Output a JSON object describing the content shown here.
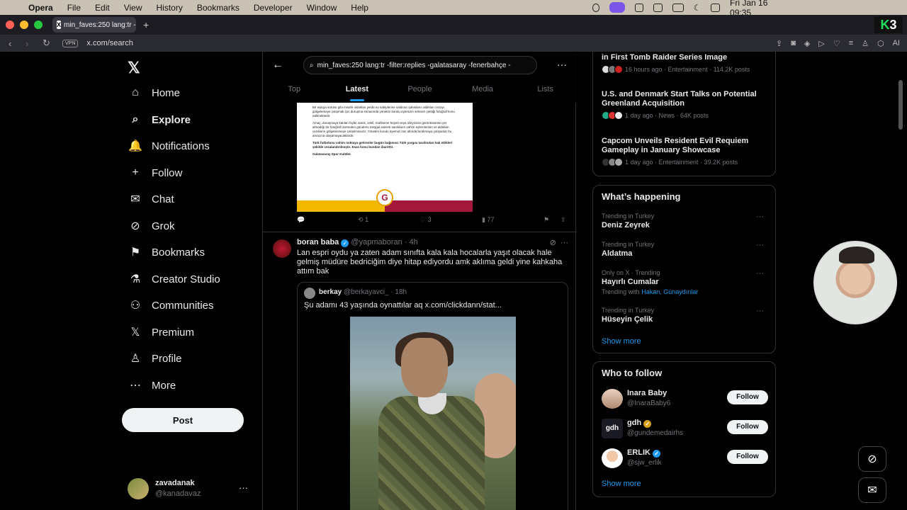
{
  "menubar": {
    "apple": "",
    "items": [
      "Opera",
      "File",
      "Edit",
      "View",
      "History",
      "Bookmarks",
      "Developer",
      "Window",
      "Help"
    ],
    "clock": "Fri Jan 16  09:35"
  },
  "tabbar": {
    "tab_title": "min_faves:250 lang:tr -f",
    "tab_icon": "X",
    "new_tab": "+",
    "badge_k": "K",
    "badge_num": "3"
  },
  "address": {
    "vpn": "VPN",
    "url": "x.com/search",
    "ai_label": "AI"
  },
  "sidebar": {
    "logo": "𝕏",
    "items": [
      {
        "label": "Home",
        "icon": "⌂"
      },
      {
        "label": "Explore",
        "icon": "⌕"
      },
      {
        "label": "Notifications",
        "icon": "🔔"
      },
      {
        "label": "Follow",
        "icon": "+"
      },
      {
        "label": "Chat",
        "icon": "✉"
      },
      {
        "label": "Grok",
        "icon": "⊘"
      },
      {
        "label": "Bookmarks",
        "icon": "⚑"
      },
      {
        "label": "Creator Studio",
        "icon": "⚗"
      },
      {
        "label": "Communities",
        "icon": "⚇"
      },
      {
        "label": "Premium",
        "icon": "𝕏"
      },
      {
        "label": "Profile",
        "icon": "♙"
      },
      {
        "label": "More",
        "icon": "⋯"
      }
    ],
    "post_button": "Post",
    "account": {
      "name": "zavadanak",
      "handle": "@kanadavaz",
      "more": "···"
    }
  },
  "search": {
    "query": "min_faves:250 lang:tr -filter:replies -galatasaray -fenerbahçe -",
    "tabs": [
      "Top",
      "Latest",
      "People",
      "Media",
      "Lists"
    ],
    "active_tab": "Latest"
  },
  "tweet1": {
    "doc_paragraphs": [
      "Bir eşkıya sürüsü gibi misafir olduklan yerde ev sahiplerine saldıran şahısların aldıkları cezayı gölgelemeye çalışmak için duruşma esnasında yönetim kurulu üyemizin selvsen çektiği fotoğraf konu edilmektedir.",
      "Amaç, duruşmaya katılan hiçbir sanık, vekil, mahkeme heyeti veya izleyicinin görüntüsünün yer almadığı bir fotoğraf üzerinden gündemi meşgul ederek sanıkların vahim eylemlerinin ve aldıkları cezaların gölgelenmeye çalışılmasıdır. Yönetim kurulu üyemizi zan altında bırakmaya çalışanlar bu amaçına ulaşamayacaklardır.",
      "Türk futbolunu vahim noktaya getirenler bugün bağımsız Türk yargısı tarafından hak ettikleri şekilde cezalandırılmıştır. Esas konu bundan ibarettir.",
      "Galatasaray Spor Kulübü"
    ],
    "retweets": "1",
    "likes": "3",
    "views": "77"
  },
  "tweet2": {
    "name": "boran baba",
    "handle": "@yapmaboran",
    "time": "· 4h",
    "text": "Lan espri oydu ya zaten adam sınıfta kala kala hocalarla yaşıt olacak hale gelmiş müdüre bedriciğim diye hitap ediyordu amk aklıma geldi yine kahkaha attım bak",
    "quote": {
      "name": "berkay",
      "handle": "@berkayavci_",
      "time": "· 18h",
      "text": "Şu adamı 43 yaşında oynattılar aq  x.com/clickdann/stat..."
    }
  },
  "trending_news": [
    {
      "headline": "in First Tomb Raider Series Image",
      "meta": "16 hours ago · Entertainment · 114.2K posts"
    },
    {
      "headline": "U.S. and Denmark Start Talks on Potential Greenland Acquisition",
      "meta": "1 day ago · News · 64K posts"
    },
    {
      "headline": "Capcom Unveils Resident Evil Requiem Gameplay in January Showcase",
      "meta": "1 day ago · Entertainment · 39.2K posts"
    }
  ],
  "whats_happening": {
    "title": "What’s happening",
    "trends": [
      {
        "context": "Trending in Turkey",
        "name": "Deniz Zeyrek"
      },
      {
        "context": "Trending in Turkey",
        "name": "Aldatma"
      },
      {
        "context": "Only on X · Trending",
        "name": "Hayırlı Cumalar",
        "with_label": "Trending with",
        "with": "Hakan, Günaydınlar"
      },
      {
        "context": "Trending in Turkey",
        "name": "Hüseyin Çelik"
      }
    ],
    "show_more": "Show more"
  },
  "who_to_follow": {
    "title": "Who to follow",
    "users": [
      {
        "name": "Inara Baby",
        "handle": "@InaraBaby6",
        "button": "Follow"
      },
      {
        "name": "gdh",
        "handle": "@gundemedairhs",
        "button": "Follow",
        "avatar_text": "gdh"
      },
      {
        "name": "ERLIK",
        "handle": "@sjw_erlik",
        "button": "Follow"
      }
    ],
    "show_more": "Show more"
  },
  "colors": {
    "accent": "#1d9bf0",
    "background": "#000000",
    "border": "#2f3336"
  }
}
